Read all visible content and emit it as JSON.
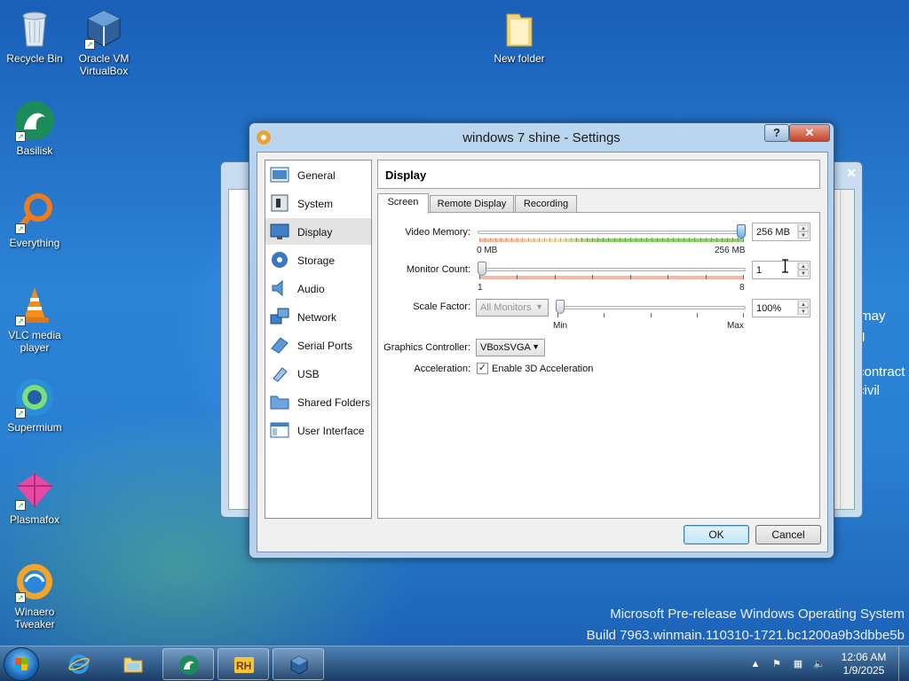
{
  "desktop": {
    "icons": [
      {
        "label": "Recycle Bin"
      },
      {
        "label": "Oracle VM VirtualBox"
      },
      {
        "label": "New folder"
      },
      {
        "label": "Basilisk"
      },
      {
        "label": "Everything"
      },
      {
        "label": "VLC media player"
      },
      {
        "label": "Supermium"
      },
      {
        "label": "Plasmafox"
      },
      {
        "label": "Winaero Tweaker"
      }
    ],
    "watermark_line1": "Microsoft Pre-release Windows Operating System",
    "watermark_line2": "Build 7963.winmain.110310-1721.bc1200a9b3dbbe5b",
    "behind_text": [
      "r may",
      "g",
      "contract",
      "civil"
    ]
  },
  "dialog": {
    "title": "windows 7 shine - Settings",
    "help_label": "?",
    "close_label": "✕",
    "sidebar": [
      {
        "label": "General",
        "icon": "general-icon"
      },
      {
        "label": "System",
        "icon": "system-icon"
      },
      {
        "label": "Display",
        "icon": "display-icon",
        "active": true
      },
      {
        "label": "Storage",
        "icon": "storage-icon"
      },
      {
        "label": "Audio",
        "icon": "audio-icon"
      },
      {
        "label": "Network",
        "icon": "network-icon"
      },
      {
        "label": "Serial Ports",
        "icon": "serial-ports-icon"
      },
      {
        "label": "USB",
        "icon": "usb-icon"
      },
      {
        "label": "Shared Folders",
        "icon": "shared-folders-icon"
      },
      {
        "label": "User Interface",
        "icon": "user-interface-icon"
      }
    ],
    "section_title": "Display",
    "tabs": [
      {
        "label": "Screen",
        "active": true
      },
      {
        "label": "Remote Display"
      },
      {
        "label": "Recording"
      }
    ],
    "video_memory": {
      "label": "Video Memory:",
      "value": "256 MB",
      "min": "0 MB",
      "max": "256 MB",
      "fraction": 1.0
    },
    "monitor_count": {
      "label": "Monitor Count:",
      "value": "1",
      "min": "1",
      "max": "8",
      "fraction": 0.0
    },
    "scale_factor": {
      "label": "Scale Factor:",
      "combo": "All Monitors",
      "value": "100%",
      "min": "Min",
      "max": "Max",
      "fraction": 0.0
    },
    "graphics_controller": {
      "label": "Graphics Controller:",
      "value": "VBoxSVGA"
    },
    "acceleration": {
      "label": "Acceleration:",
      "checkbox_label": "Enable 3D Acceleration",
      "checked": true
    },
    "ok_label": "OK",
    "cancel_label": "Cancel"
  },
  "taskbar": {
    "clock_time": "12:06 AM",
    "clock_date": "1/9/2025",
    "pinned": [
      "internet-explorer-icon",
      "explorer-icon",
      "basilisk-icon",
      "rh-icon",
      "virtualbox-icon"
    ]
  },
  "colors": {
    "slider_good": "#8fd26a",
    "slider_bad": "#f4b8a6",
    "close_red": "#c8432b"
  }
}
